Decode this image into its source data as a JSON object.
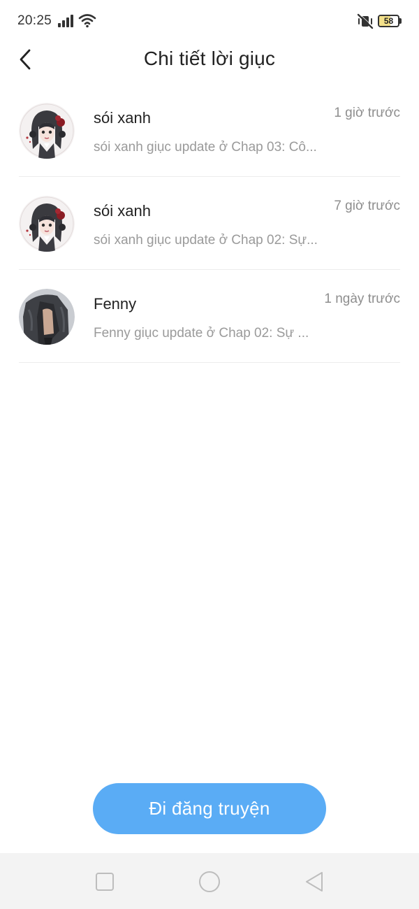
{
  "status_bar": {
    "time": "20:25",
    "battery_level": "58",
    "battery_fraction": 0.58,
    "icons": [
      "signal-icon",
      "wifi-icon",
      "mute-icon",
      "battery-icon"
    ]
  },
  "header": {
    "title": "Chi tiết lời giục",
    "back_icon": "chevron-left-icon"
  },
  "reminders": [
    {
      "name": "sói xanh",
      "time": "1 giờ trước",
      "message": "sói xanh giục update ở Chap 03: Cô...",
      "avatar": "anime-girl-avatar"
    },
    {
      "name": "sói xanh",
      "time": "7 giờ trước",
      "message": "sói xanh giục update ở Chap 02: Sự...",
      "avatar": "anime-girl-avatar"
    },
    {
      "name": "Fenny",
      "time": "1 ngày trước",
      "message": "Fenny giục update ở Chap 02: Sự ...",
      "avatar": "jacket-photo-avatar"
    }
  ],
  "actions": {
    "publish_label": "Đi đăng truyện"
  },
  "colors": {
    "accent": "#5aacf5",
    "background": "#ffffff",
    "nav_bar": "#f3f3f3",
    "secondary_text": "#8e8e8e"
  },
  "nav_bar": {
    "buttons": [
      "recent-apps-icon",
      "home-icon",
      "back-triangle-icon"
    ]
  }
}
